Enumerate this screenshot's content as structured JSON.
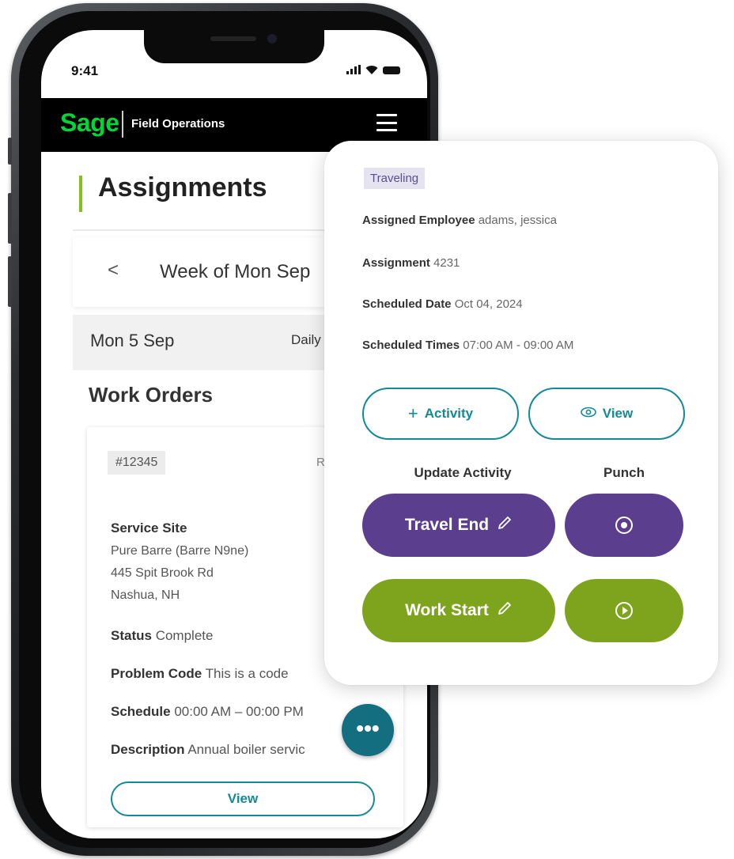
{
  "status_bar": {
    "time": "9:41"
  },
  "header": {
    "logo": "Sage",
    "app_name": "Field Operations"
  },
  "page": {
    "title": "Assignments"
  },
  "week_nav": {
    "prev_glyph": "<",
    "label": "Week of Mon  Sep"
  },
  "day_bar": {
    "date": "Mon 5 Sep",
    "daily_label": "Daily T"
  },
  "work_orders": {
    "title": "Work Orders",
    "card": {
      "id": "#12345",
      "ring_label": "Rin",
      "service_site_label": "Service Site",
      "address_lines": [
        "Pure Barre (Barre N9ne)",
        "445 Spit Brook Rd",
        "Nashua, NH"
      ],
      "status_label": "Status",
      "status_value": "Complete",
      "problem_label": "Problem Code",
      "problem_value": "This is a code",
      "schedule_label": "Schedule",
      "schedule_value": "00:00 AM – 00:00 PM",
      "description_label": "Description",
      "description_value": "Annual boiler servic",
      "view_label": "View"
    },
    "fab_label": "•••"
  },
  "popup": {
    "badge": "Traveling",
    "assigned_employee_label": "Assigned Employee",
    "assigned_employee_value": "adams, jessica",
    "assignment_label": "Assignment",
    "assignment_value": "4231",
    "scheduled_date_label": "Scheduled Date",
    "scheduled_date_value": "Oct 04, 2024",
    "scheduled_times_label": "Scheduled Times",
    "scheduled_times_value": "07:00 AM - 09:00 AM",
    "add_activity_label": "Activity",
    "view_label": "View",
    "update_activity_label": "Update Activity",
    "punch_label": "Punch",
    "travel_end_label": "Travel End",
    "work_start_label": "Work Start"
  },
  "colors": {
    "brand_green": "#00d639",
    "teal": "#138a96",
    "purple": "#5b3e8e",
    "olive_green": "#7da41c",
    "accent_bar": "#7fc31c"
  }
}
